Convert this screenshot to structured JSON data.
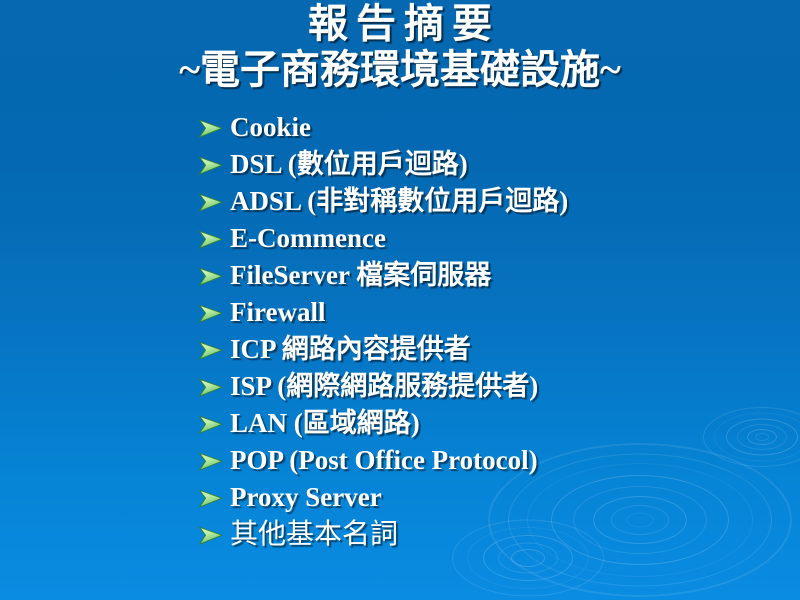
{
  "slide": {
    "title": {
      "line1": "報告摘要",
      "line2": "~電子商務環境基礎設施~"
    },
    "bullet_marker_icon": "arrow-bullet-icon",
    "colors": {
      "background_top": "#0568b0",
      "background_bottom": "#0a8ce2",
      "text": "#ffffff",
      "bullet_light": "#c6f0a8",
      "bullet_dark": "#3f9b4a"
    },
    "items": [
      {
        "text": "Cookie",
        "cjk_only": false
      },
      {
        "text": "DSL (數位用戶迴路)",
        "cjk_only": false
      },
      {
        "text": "ADSL (非對稱數位用戶迴路)",
        "cjk_only": false
      },
      {
        "text": "E-Commence",
        "cjk_only": false
      },
      {
        "text": "FileServer  檔案伺服器",
        "cjk_only": false
      },
      {
        "text": "Firewall",
        "cjk_only": false
      },
      {
        "text": "ICP 網路內容提供者",
        "cjk_only": false
      },
      {
        "text": "ISP (網際網路服務提供者)",
        "cjk_only": false
      },
      {
        "text": "LAN  (區域網路)",
        "cjk_only": false
      },
      {
        "text": "POP (Post Office Protocol)",
        "cjk_only": false
      },
      {
        "text": "Proxy Server",
        "cjk_only": false
      },
      {
        "text": "其他基本名詞",
        "cjk_only": true
      }
    ]
  }
}
